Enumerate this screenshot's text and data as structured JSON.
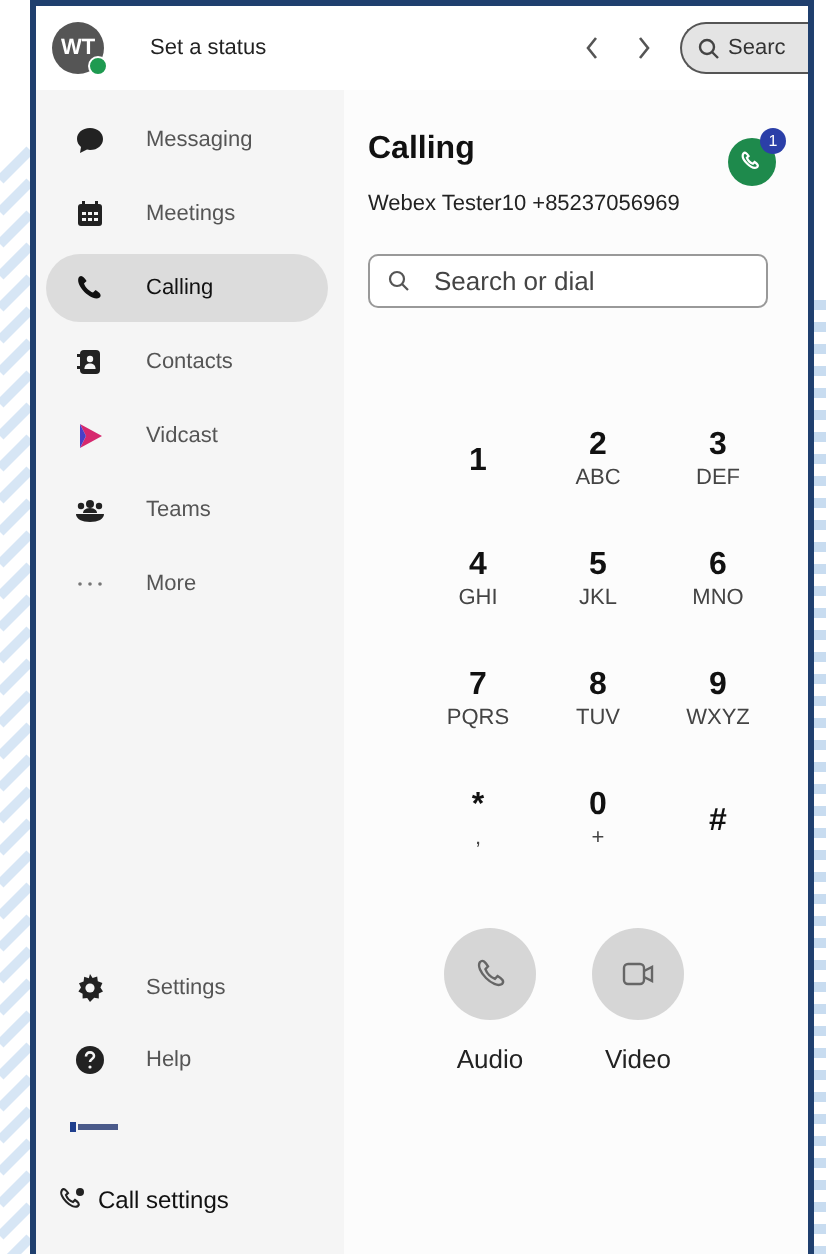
{
  "header": {
    "status_placeholder": "Set a status",
    "avatar_initials": "WT",
    "online": true,
    "search_label": "Searc"
  },
  "sidebar": {
    "items": [
      {
        "label": "Messaging",
        "kind": "messaging",
        "selected": false
      },
      {
        "label": "Meetings",
        "kind": "meetings",
        "selected": false
      },
      {
        "label": "Calling",
        "kind": "calling",
        "selected": true
      },
      {
        "label": "Contacts",
        "kind": "contacts",
        "selected": false
      },
      {
        "label": "Vidcast",
        "kind": "vidcast",
        "selected": false
      },
      {
        "label": "Teams",
        "kind": "teams",
        "selected": false
      },
      {
        "label": "More",
        "kind": "more",
        "selected": false
      }
    ],
    "bottom_items": [
      {
        "label": "Settings",
        "kind": "settings"
      },
      {
        "label": "Help",
        "kind": "help"
      }
    ],
    "call_settings": "Call settings"
  },
  "calling": {
    "title": "Calling",
    "line": "Webex Tester10 +85237056969",
    "badge": "1",
    "search": {
      "placeholder": "Search or dial"
    },
    "keys": [
      {
        "digit": "1"
      },
      {
        "digit": "2",
        "letters": "ABC"
      },
      {
        "digit": "3",
        "letters": "DEF"
      },
      {
        "digit": "4",
        "letters": "GHI"
      },
      {
        "digit": "5",
        "letters": "JKL"
      },
      {
        "digit": "6",
        "letters": "MNO"
      },
      {
        "digit": "7",
        "letters": "PQRS"
      },
      {
        "digit": "8",
        "letters": "TUV"
      },
      {
        "digit": "9",
        "letters": "WXYZ"
      },
      {
        "digit": "*",
        "letters": ","
      },
      {
        "digit": "0",
        "letters": "+"
      },
      {
        "digit": "#"
      }
    ],
    "actions": [
      {
        "label": "Audio",
        "kind": "audio"
      },
      {
        "label": "Video",
        "kind": "video"
      }
    ]
  }
}
